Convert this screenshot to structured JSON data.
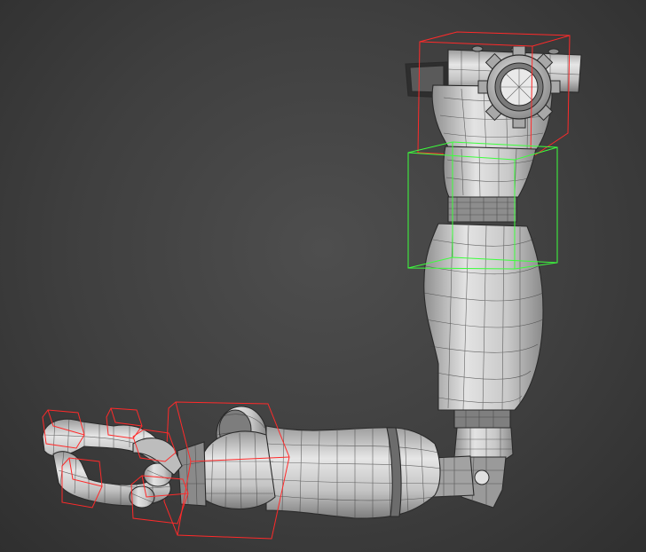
{
  "viewport": {
    "background_top": "#4e4e4e",
    "background_bottom": "#2f2f2f"
  },
  "model": {
    "mesh_fill": "#cfcfcf",
    "mesh_shade": "#9a9a9a",
    "wire_color": "#3b3b3b"
  },
  "selection": {
    "primary_color": "#ff2a2a",
    "secondary_color": "#3cff3c"
  },
  "icons": [
    "gear-icon"
  ]
}
